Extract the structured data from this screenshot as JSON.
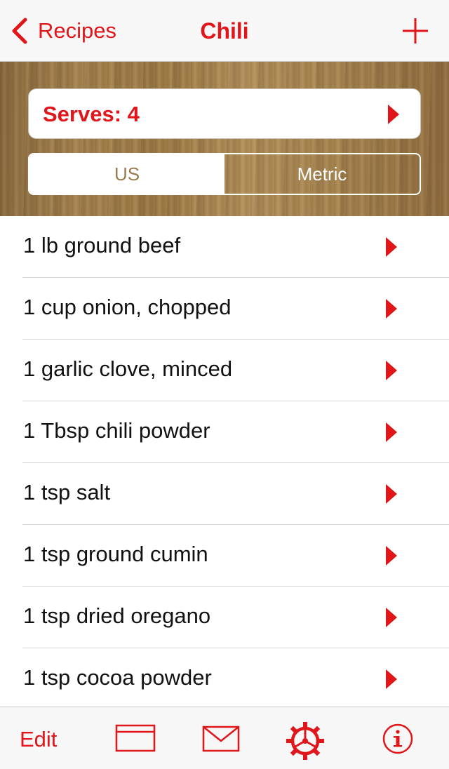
{
  "colors": {
    "accent": "#e0161b",
    "text": "#111111",
    "segment_selected_text": "#9b7b4c"
  },
  "navbar": {
    "back_label": "Recipes",
    "title": "Chili",
    "add_icon": "plus-icon",
    "back_icon": "chevron-left-icon"
  },
  "serves": {
    "label": "Serves: 4",
    "icon": "disclosure-arrow-icon"
  },
  "units": {
    "options": [
      "US",
      "Metric"
    ],
    "selected": "US"
  },
  "ingredients": [
    "1 lb ground beef",
    "1 cup onion, chopped",
    "1 garlic clove, minced",
    "1 Tbsp chili powder",
    "1 tsp salt",
    "1 tsp ground cumin",
    "1 tsp dried oregano",
    "1 tsp cocoa powder"
  ],
  "toolbar": {
    "edit_label": "Edit",
    "icons": [
      "card-icon",
      "mail-icon",
      "gear-icon",
      "info-icon"
    ]
  }
}
